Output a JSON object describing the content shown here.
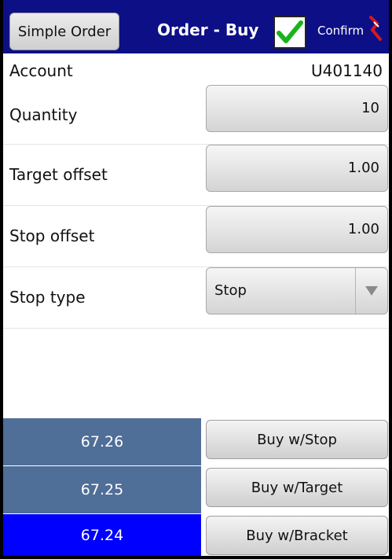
{
  "header": {
    "simple_order_label": "Simple Order",
    "title": "Order - Buy",
    "confirm_label": "Confirm",
    "confirm_checked": true,
    "bar_color": "#0d0f86"
  },
  "form": {
    "account": {
      "label": "Account",
      "value": "U401140"
    },
    "quantity": {
      "label": "Quantity",
      "value": "10"
    },
    "target_offset": {
      "label": "Target offset",
      "value": "1.00"
    },
    "stop_offset": {
      "label": "Stop offset",
      "value": "1.00"
    },
    "stop_type": {
      "label": "Stop type",
      "value": "Stop"
    }
  },
  "price_rows": [
    {
      "price": "67.26",
      "action": "Buy w/Stop",
      "color": "#4f6e98"
    },
    {
      "price": "67.25",
      "action": "Buy w/Target",
      "color": "#4f6e98"
    },
    {
      "price": "67.24",
      "action": "Buy w/Bracket",
      "color": "#0000ff"
    }
  ]
}
